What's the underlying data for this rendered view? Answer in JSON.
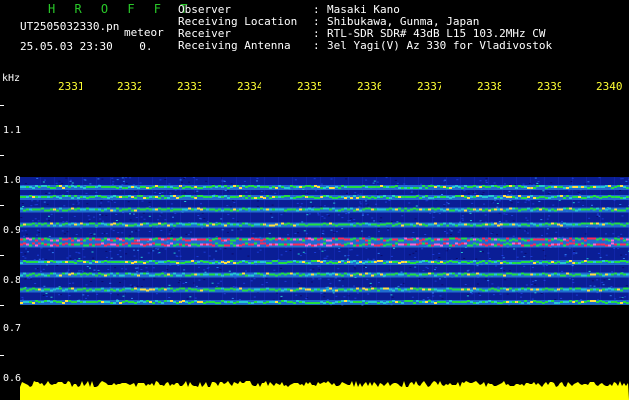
{
  "header": {
    "brand": "H R O F F T",
    "filename": "UT2505032330.pn",
    "meteor_label": "meteor",
    "date": "25.05.03",
    "time": "23:30",
    "count": "0."
  },
  "info": [
    {
      "key": "Observer",
      "value": "Masaki Kano"
    },
    {
      "key": "Receiving Location",
      "value": "Shibukawa, Gunma, Japan"
    },
    {
      "key": "Receiver",
      "value": "RTL-SDR SDR# 43dB L15 103.2MHz CW"
    },
    {
      "key": "Receiving Antenna",
      "value": "3el Yagi(V) Az 330 for Vladivostok"
    }
  ],
  "axis": {
    "unit": "kHz",
    "x_ticks": [
      "2331",
      "2332",
      "2333",
      "2334",
      "2335",
      "2336",
      "2337",
      "2338",
      "2339",
      "2340"
    ],
    "y_ticks": [
      "1.1",
      "1.0",
      "0.9",
      "0.8",
      "0.7",
      "0.6"
    ]
  },
  "colors": {
    "background": "#000000",
    "header_text": "#ffffff",
    "brand": "#29c829",
    "time_labels": "#ffff33",
    "waterfall_base": "#0a1e96",
    "band_strong": "#ff2a55",
    "band_mid": "#22dd44",
    "noise_floor": "#ffff00"
  },
  "waterfall": {
    "bands_khz": [
      0.99,
      0.97,
      0.945,
      0.915,
      0.885,
      0.875,
      0.84,
      0.815,
      0.785,
      0.76
    ],
    "band_region_khz": [
      0.755,
      1.01
    ],
    "noise_floor_khz": 0.6
  }
}
